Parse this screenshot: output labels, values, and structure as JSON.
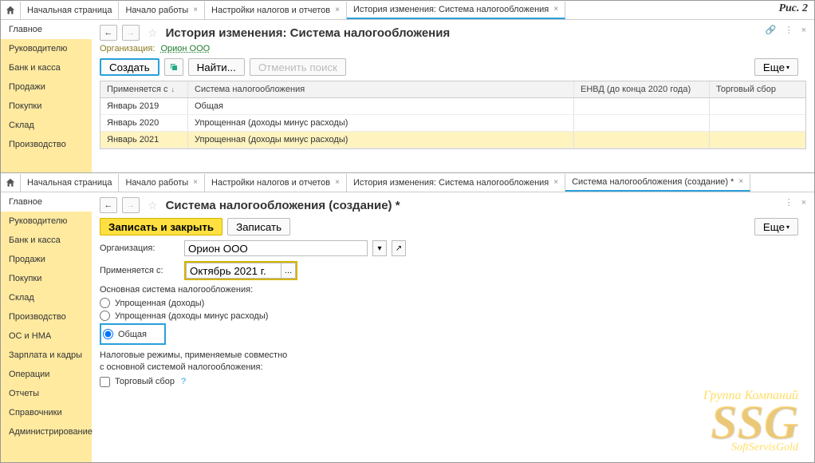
{
  "figure_label": "Рис. 2",
  "panel1": {
    "tabs": {
      "home": "Начальная страница",
      "t1": "Начало работы",
      "t2": "Настройки налогов и отчетов",
      "t3": "История изменения: Система налогообложения"
    },
    "sidebar": {
      "items": [
        "Главное",
        "Руководителю",
        "Банк и касса",
        "Продажи",
        "Покупки",
        "Склад",
        "Производство"
      ]
    },
    "title": "История изменения: Система налогообложения",
    "org_label": "Организация:",
    "org_value": "Орион ООО",
    "toolbar": {
      "create": "Создать",
      "find": "Найти...",
      "cancel_search": "Отменить поиск",
      "more": "Еще"
    },
    "table": {
      "headers": {
        "c1": "Применяется с",
        "c2": "Система налогообложения",
        "c3": "ЕНВД (до конца 2020 года)",
        "c4": "Торговый сбор"
      },
      "rows": [
        {
          "c1": "Январь 2019",
          "c2": "Общая",
          "c3": "",
          "c4": ""
        },
        {
          "c1": "Январь 2020",
          "c2": "Упрощенная (доходы минус расходы)",
          "c3": "",
          "c4": ""
        },
        {
          "c1": "Январь 2021",
          "c2": "Упрощенная (доходы минус расходы)",
          "c3": "",
          "c4": ""
        }
      ]
    }
  },
  "panel2": {
    "tabs": {
      "home": "Начальная страница",
      "t1": "Начало работы",
      "t2": "Настройки налогов и отчетов",
      "t3": "История изменения: Система налогообложения",
      "t4": "Система налогообложения (создание) *"
    },
    "sidebar": {
      "items": [
        "Главное",
        "Руководителю",
        "Банк и касса",
        "Продажи",
        "Покупки",
        "Склад",
        "Производство",
        "ОС и НМА",
        "Зарплата и кадры",
        "Операции",
        "Отчеты",
        "Справочники",
        "Администрирование"
      ]
    },
    "title": "Система налогообложения (создание) *",
    "toolbar": {
      "save_close": "Записать и закрыть",
      "save": "Записать",
      "more": "Еще"
    },
    "form": {
      "org_label": "Организация:",
      "org_value": "Орион ООО",
      "date_label": "Применяется с:",
      "date_value": "Октябрь 2021 г.",
      "section_label": "Основная система налогообложения:",
      "radio1": "Упрощенная (доходы)",
      "radio2": "Упрощенная (доходы минус расходы)",
      "radio3": "Общая",
      "note": "Налоговые режимы, применяемые совместно\nс основной системой налогообложения:",
      "check1": "Торговый сбор",
      "help": "?"
    }
  },
  "watermark": {
    "gk": "Группа Компаний",
    "ssg": "SSG",
    "sub": "SoftServisGold"
  }
}
